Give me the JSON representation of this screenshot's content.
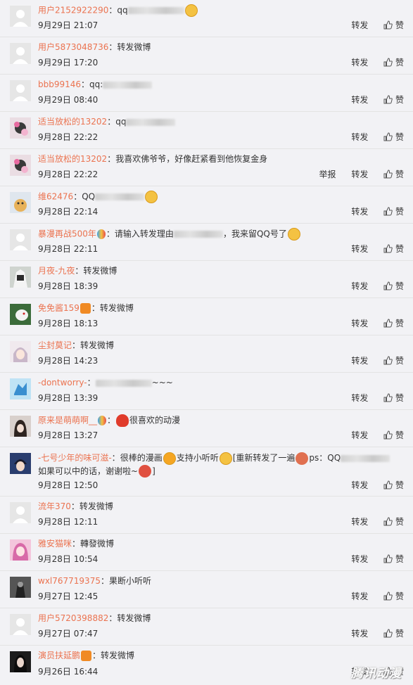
{
  "actions": {
    "forward": "转发",
    "like": "赞",
    "report": "举报"
  },
  "comments": [
    {
      "user": "用户2152922290",
      "sep": "：",
      "text": "qq",
      "time": "9月29日 21:07"
    },
    {
      "user": "用户5873048736",
      "sep": "：",
      "text": "转发微博",
      "time": "9月29日 17:20"
    },
    {
      "user": "bbb99146",
      "sep": "：",
      "text": "qq:",
      "time": "9月29日 08:40"
    },
    {
      "user": "适当放松的13202",
      "sep": "：",
      "text": "qq",
      "time": "9月28日 22:22"
    },
    {
      "user": "适当放松的13202",
      "sep": "：",
      "text": "我喜欢佛爷爷，好像赶紧看到他恢复金身",
      "time": "9月28日 22:22"
    },
    {
      "user": "维62476",
      "sep": "：",
      "text": "QQ",
      "time": "9月28日 22:14"
    },
    {
      "user": "暴漫再战500年",
      "sep": "：",
      "text": "请输入转发理由",
      "text2": "，我来留QQ号了",
      "time": "9月28日 22:11"
    },
    {
      "user": "月夜-九夜",
      "sep": "：",
      "text": "转发微博",
      "time": "9月28日 18:39"
    },
    {
      "user": "免免酱159",
      "sep": "：",
      "text": "转发微博",
      "time": "9月28日 18:13"
    },
    {
      "user": "尘封莫记",
      "sep": "：",
      "text": "转发微博",
      "time": "9月28日 14:23"
    },
    {
      "user": "-dontworry-",
      "sep": "：",
      "text": "~~~",
      "time": "9月28日 13:39"
    },
    {
      "user": "原来是萌萌啊__",
      "sep": "：",
      "text": "很喜欢的动漫",
      "time": "9月28日 13:27"
    },
    {
      "user": "-七号少年的味可滋-",
      "sep": "：",
      "text": "很棒的漫画",
      "text2": "支持小听听",
      "text3": "[重新转发了一遍",
      "text4": "ps：QQ",
      "text5": "如果可以中的话，谢谢啦~",
      "text6": "]",
      "time": "9月28日 12:50"
    },
    {
      "user": "流年370",
      "sep": "：",
      "text": "转发微博",
      "time": "9月28日 12:11"
    },
    {
      "user": "雅安猫咪",
      "sep": "：",
      "text": "轉發微博",
      "time": "9月28日 10:54"
    },
    {
      "user": "wxl767719375",
      "sep": "：",
      "text": "果断小听听",
      "time": "9月27日 12:45"
    },
    {
      "user": "用户5720398882",
      "sep": "：",
      "text": "转发微博",
      "time": "9月27日 07:47"
    },
    {
      "user": "演员扶延鹏",
      "sep": "：",
      "text": "转发微博",
      "time": "9月26日 16:44"
    }
  ],
  "watermark": "腾讯动漫",
  "colors": {
    "username": "#eb7350",
    "background": "#f2f2f5",
    "divider": "#e3e3e3"
  }
}
